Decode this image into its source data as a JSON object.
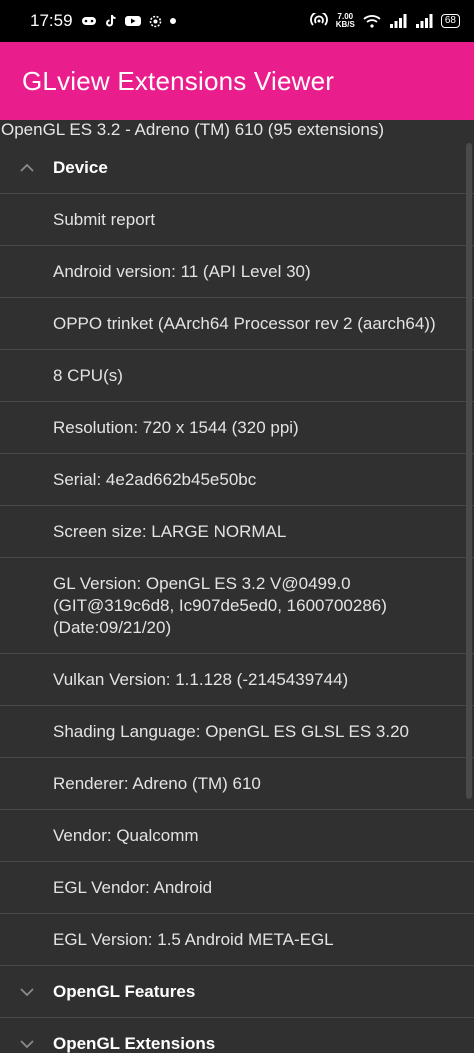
{
  "status": {
    "time": "17:59",
    "speed_value": "7.00",
    "speed_unit": "KB/S",
    "battery": "68"
  },
  "app": {
    "title": "GLview Extensions Viewer",
    "subtitle": "OpenGL ES 3.2 - Adreno (TM) 610 (95 extensions)"
  },
  "groups": {
    "device": "Device",
    "features": "OpenGL Features",
    "extensions": "OpenGL Extensions"
  },
  "device_items": [
    "Submit report",
    "Android version: 11 (API Level 30)",
    "OPPO  trinket (AArch64 Processor rev 2 (aarch64))",
    "8 CPU(s)",
    "Resolution: 720 x 1544 (320 ppi)",
    "Serial: 4e2ad662b45e50bc",
    "Screen size: LARGE NORMAL",
    "GL Version: OpenGL ES 3.2 V@0499.0 (GIT@319c6d8, Ic907de5ed0, 1600700286) (Date:09/21/20)",
    "Vulkan Version: 1.1.128 (-2145439744)",
    "Shading Language: OpenGL ES GLSL ES 3.20",
    "Renderer: Adreno (TM) 610",
    "Vendor: Qualcomm",
    "EGL Vendor: Android",
    "EGL Version: 1.5 Android META-EGL"
  ]
}
